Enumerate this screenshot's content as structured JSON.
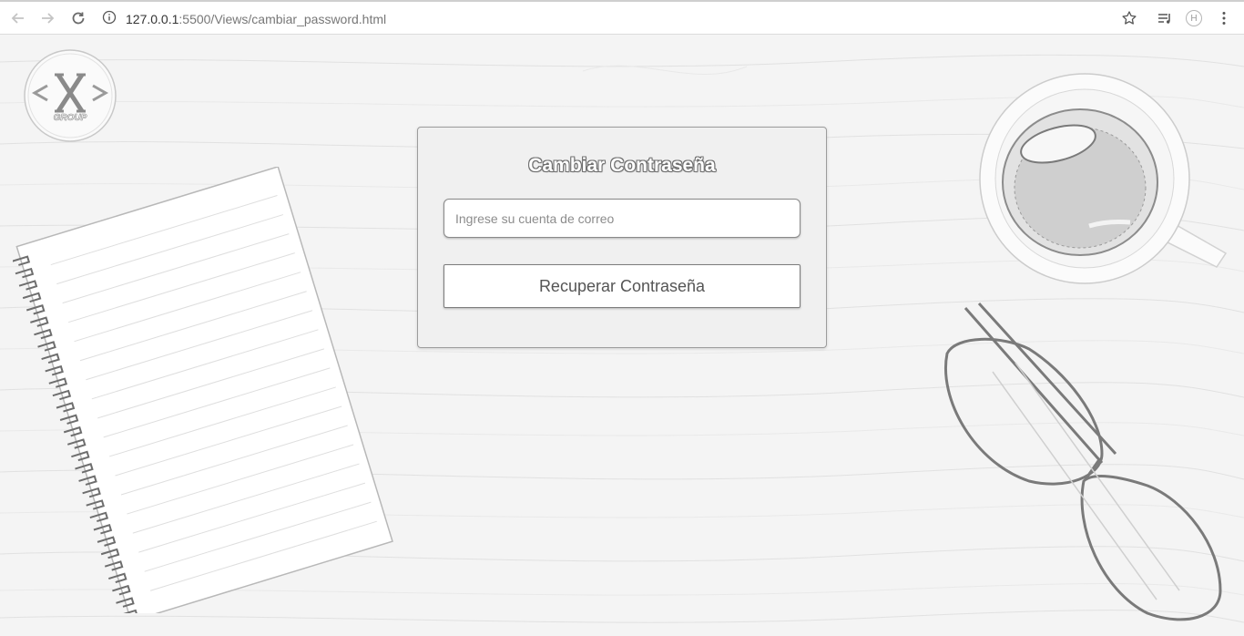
{
  "browser": {
    "url_host": "127.0.0.1",
    "url_path": ":5500/Views/cambiar_password.html",
    "profile_initial": "H",
    "icons": [
      "back-arrow-icon",
      "forward-arrow-icon",
      "reload-icon",
      "info-icon",
      "star-icon",
      "reading-list-icon",
      "menu-dots-icon"
    ]
  },
  "logo": {
    "text": "GROUP"
  },
  "form": {
    "title": "Cambiar Contraseña",
    "email_placeholder": "Ingrese su cuenta de correo",
    "email_value": "",
    "submit_label": "Recuperar Contraseña"
  },
  "colors": {
    "background": "#f4f4f4",
    "card": "#f0f0f0",
    "border": "#9c9c9c",
    "text": "#555555"
  }
}
